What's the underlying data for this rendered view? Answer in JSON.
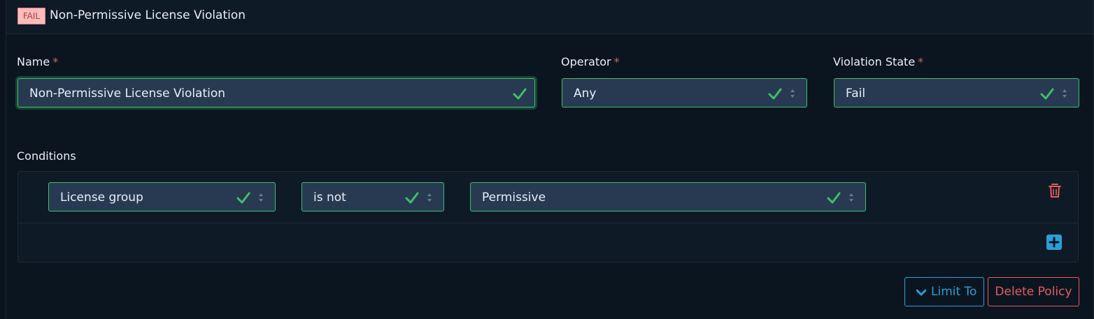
{
  "header": {
    "badge": "FAIL",
    "title": "Non-Permissive License Violation"
  },
  "form": {
    "name": {
      "label": "Name",
      "required_mark": "*",
      "value": "Non-Permissive License Violation"
    },
    "operator": {
      "label": "Operator",
      "required_mark": "*",
      "value": "Any"
    },
    "violation_state": {
      "label": "Violation State",
      "required_mark": "*",
      "value": "Fail"
    }
  },
  "conditions": {
    "label": "Conditions",
    "rows": [
      {
        "subject": "License group",
        "operator": "is not",
        "value": "Permissive"
      }
    ]
  },
  "actions": {
    "limit_to": "Limit To",
    "delete_policy": "Delete Policy"
  },
  "colors": {
    "success": "#3fbf6b",
    "danger": "#e35d5d",
    "info": "#2a9fd6",
    "field_bg": "#283a52",
    "page_bg": "#0a131e"
  },
  "icons": [
    "check-icon",
    "sort-arrows-icon",
    "trash-icon",
    "plus-square-icon",
    "chevron-down-icon"
  ]
}
